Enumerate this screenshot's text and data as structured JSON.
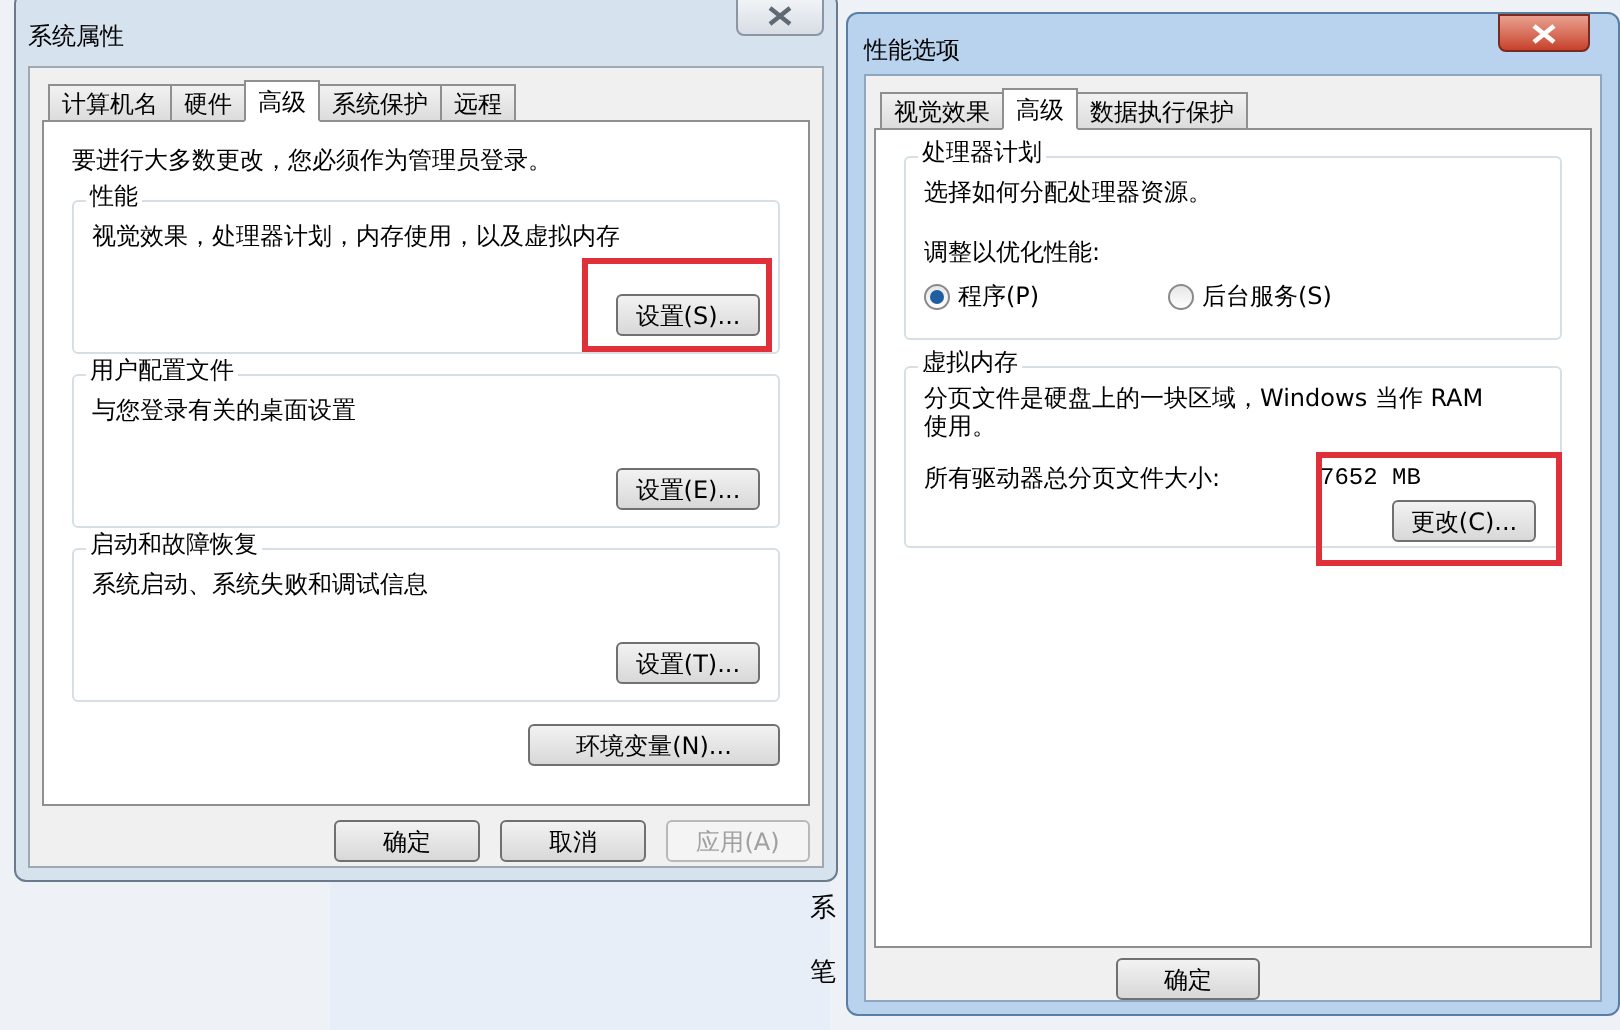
{
  "background": {
    "fragments": [
      "系",
      "笔"
    ]
  },
  "system_properties": {
    "title": "系统属性",
    "tabs": [
      {
        "label": "计算机名",
        "selected": false
      },
      {
        "label": "硬件",
        "selected": false
      },
      {
        "label": "高级",
        "selected": true
      },
      {
        "label": "系统保护",
        "selected": false
      },
      {
        "label": "远程",
        "selected": false
      }
    ],
    "notice": "要进行大多数更改，您必须作为管理员登录。",
    "groups": [
      {
        "title": "性能",
        "description": "视觉效果，处理器计划，内存使用，以及虚拟内存",
        "button": "设置(S)...",
        "highlighted": true
      },
      {
        "title": "用户配置文件",
        "description": "与您登录有关的桌面设置",
        "button": "设置(E)...",
        "highlighted": false
      },
      {
        "title": "启动和故障恢复",
        "description": "系统启动、系统失败和调试信息",
        "button": "设置(T)...",
        "highlighted": false
      }
    ],
    "env_button": "环境变量(N)...",
    "footer_buttons": [
      {
        "label": "确定",
        "disabled": false
      },
      {
        "label": "取消",
        "disabled": false
      },
      {
        "label": "应用(A)",
        "disabled": true
      }
    ]
  },
  "performance_options": {
    "title": "性能选项",
    "tabs": [
      {
        "label": "视觉效果",
        "selected": false
      },
      {
        "label": "高级",
        "selected": true
      },
      {
        "label": "数据执行保护",
        "selected": false
      }
    ],
    "processor": {
      "title": "处理器计划",
      "description": "选择如何分配处理器资源。",
      "adjust_label": "调整以优化性能:",
      "options": [
        {
          "label": "程序(P)",
          "selected": true
        },
        {
          "label": "后台服务(S)",
          "selected": false
        }
      ]
    },
    "virtual_memory": {
      "title": "虚拟内存",
      "description": "分页文件是硬盘上的一块区域，Windows 当作 RAM 使用。",
      "total_label": "所有驱动器总分页文件大小:",
      "total_value": "7652 MB",
      "button": "更改(C)...",
      "highlighted": true
    },
    "footer_buttons": [
      {
        "label": "确定",
        "disabled": false
      }
    ]
  }
}
